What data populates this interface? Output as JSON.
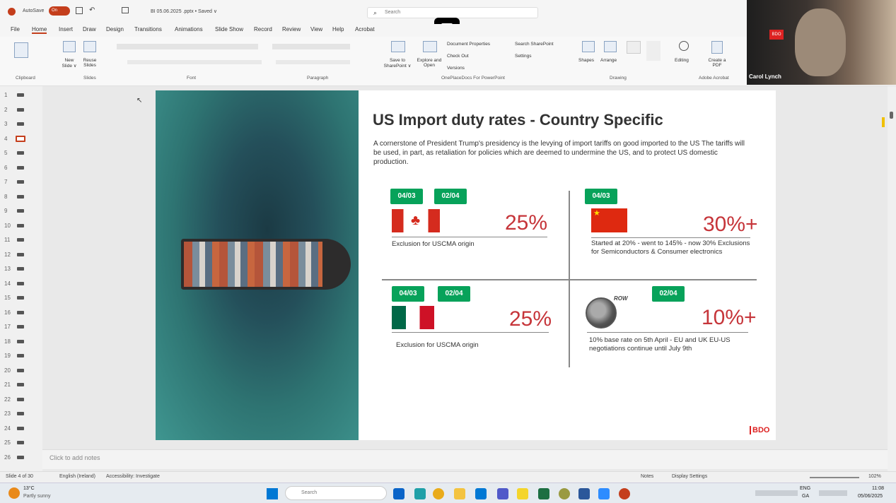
{
  "app": {
    "autosave": "AutoSave",
    "toggle": "On",
    "filename": "BI 05.06.2025 .pptx • Saved ∨",
    "search": "Search"
  },
  "menu": [
    "File",
    "Home",
    "Insert",
    "Draw",
    "Design",
    "Transitions",
    "Animations",
    "Slide Show",
    "Record",
    "Review",
    "View",
    "Help",
    "Acrobat"
  ],
  "ribbon": {
    "new_slide": "New Slide ∨",
    "reuse": "Reuse Slides",
    "save_sp": "Save to SharePoint ∨",
    "explore": "Explore and Open",
    "docprops": "Document Properties",
    "checkout": "Check Out",
    "versions": "Versions",
    "searchsp": "Search SharePoint",
    "settings": "Settings",
    "shapes": "Shapes",
    "arrange": "Arrange",
    "editing": "Editing",
    "createpdf": "Create a PDF",
    "groups": {
      "clipboard": "Clipboard",
      "slides": "Slides",
      "font": "Font",
      "paragraph": "Paragraph",
      "onepd": "OnePlaceDocs For PowerPoint",
      "drawing": "Drawing",
      "acrobat": "Adobe Acrobat"
    }
  },
  "video": {
    "name": "Carol Lynch",
    "logo": "BDO"
  },
  "thumbs": [
    "1",
    "2",
    "3",
    "4",
    "5",
    "6",
    "7",
    "8",
    "9",
    "10",
    "11",
    "12",
    "13",
    "14",
    "15",
    "16",
    "17",
    "18",
    "19",
    "20",
    "21",
    "22",
    "23",
    "24",
    "25",
    "26"
  ],
  "slide": {
    "title": "US Import duty rates - Country Specific",
    "intro": "A cornerstone of  President Trump's presidency is the levying of import tariffs on good imported to the US The tariffs will be used, in part, as retaliation for policies which are deemed to undermine the US, and to protect US domestic production.",
    "q1": {
      "d1": "04/03",
      "d2": "02/04",
      "pct": "25%",
      "note": "Exclusion for USCMA origin"
    },
    "q2": {
      "d1": "04/03",
      "pct": "30%+",
      "note": "Started at 20% - went to 145% - now 30% Exclusions for Semiconductors & Consumer electronics"
    },
    "q3": {
      "d1": "04/03",
      "d2": "02/04",
      "pct": "25%",
      "note": "Exclusion for USCMA origin"
    },
    "q4": {
      "row": "ROW",
      "d1": "02/04",
      "pct": "10%+",
      "note": "10% base rate on 5th April  - EU and UK EU-US negotiations continue until July 9th"
    },
    "logo": "BDO",
    "accent": "#c6353a",
    "badge": "#07a25a"
  },
  "notes": "Click to add notes",
  "status": {
    "slide": "Slide 4 of 30",
    "lang": "English (Ireland)",
    "access": "Accessibility: Investigate",
    "notes": "Notes",
    "display": "Display Settings",
    "zoom": "102%"
  },
  "taskbar": {
    "weather": "13°C",
    "weather2": "Partly sunny",
    "search": "Search",
    "lang": "ENG",
    "lang2": "GA",
    "time": "11:08",
    "date": "05/06/2025"
  }
}
